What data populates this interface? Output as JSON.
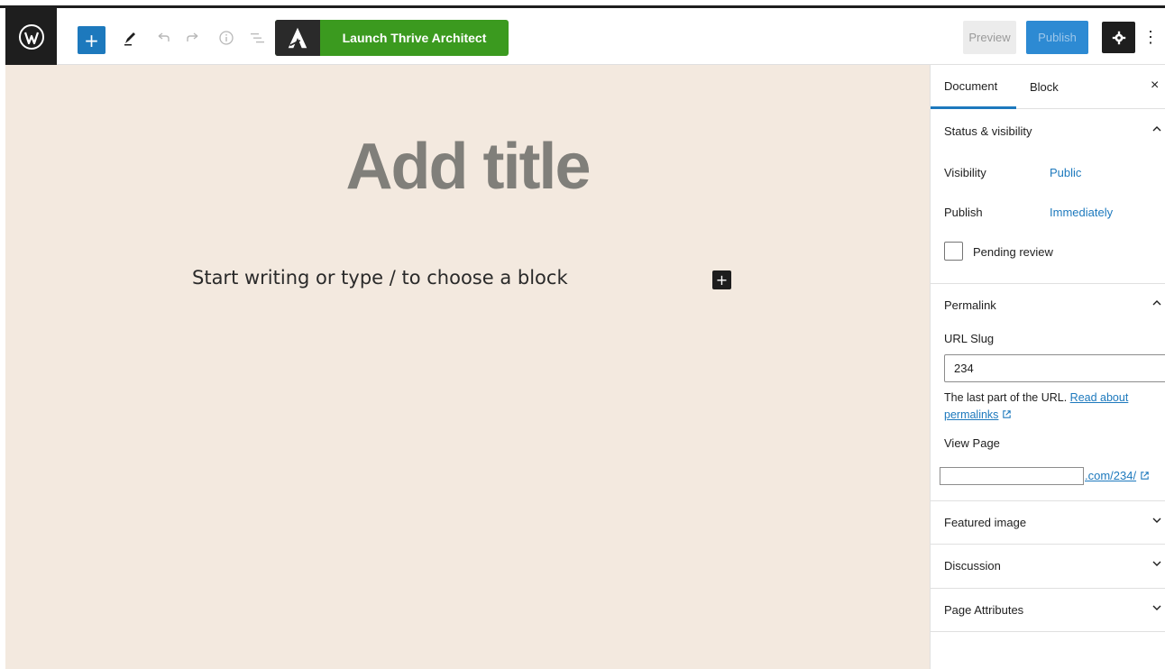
{
  "toolbar": {
    "thrive_label": "Launch Thrive Architect",
    "preview_label": "Preview",
    "publish_label": "Publish",
    "more_label": "⋮",
    "add_label": "+"
  },
  "editor": {
    "title_placeholder": "Add title",
    "paragraph_placeholder": "Start writing or type / to choose a block",
    "inline_add_label": "+"
  },
  "sidebar": {
    "tabs": [
      {
        "label": "Document",
        "active": true
      },
      {
        "label": "Block",
        "active": false
      }
    ],
    "close_label": "×",
    "status_visibility": {
      "title": "Status & visibility",
      "visibility_label": "Visibility",
      "visibility_value": "Public",
      "publish_label": "Publish",
      "publish_value": "Immediately",
      "pending_review_label": "Pending review"
    },
    "permalink": {
      "title": "Permalink",
      "url_slug_label": "URL Slug",
      "url_slug_value": "234",
      "help_text": "The last part of the URL.",
      "help_link": "Read about permalinks",
      "view_page_label": "View Page",
      "view_page_link": ".com/234/"
    },
    "panels_collapsed": [
      {
        "title": "Featured image"
      },
      {
        "title": "Discussion"
      },
      {
        "title": "Page Attributes"
      }
    ]
  },
  "colors": {
    "accent": "#1d79bd",
    "canvas_bg": "#f3e9df",
    "thrive_green": "#3b9a1f",
    "dark": "#1e1e1e"
  },
  "icons": [
    "wordpress-icon",
    "plus-icon",
    "pencil-icon",
    "undo-icon",
    "redo-icon",
    "info-icon",
    "list-view-icon",
    "thrive-logo-icon",
    "gear-icon",
    "more-vertical-icon",
    "close-icon",
    "chevron-up-icon",
    "chevron-down-icon",
    "external-link-icon"
  ]
}
